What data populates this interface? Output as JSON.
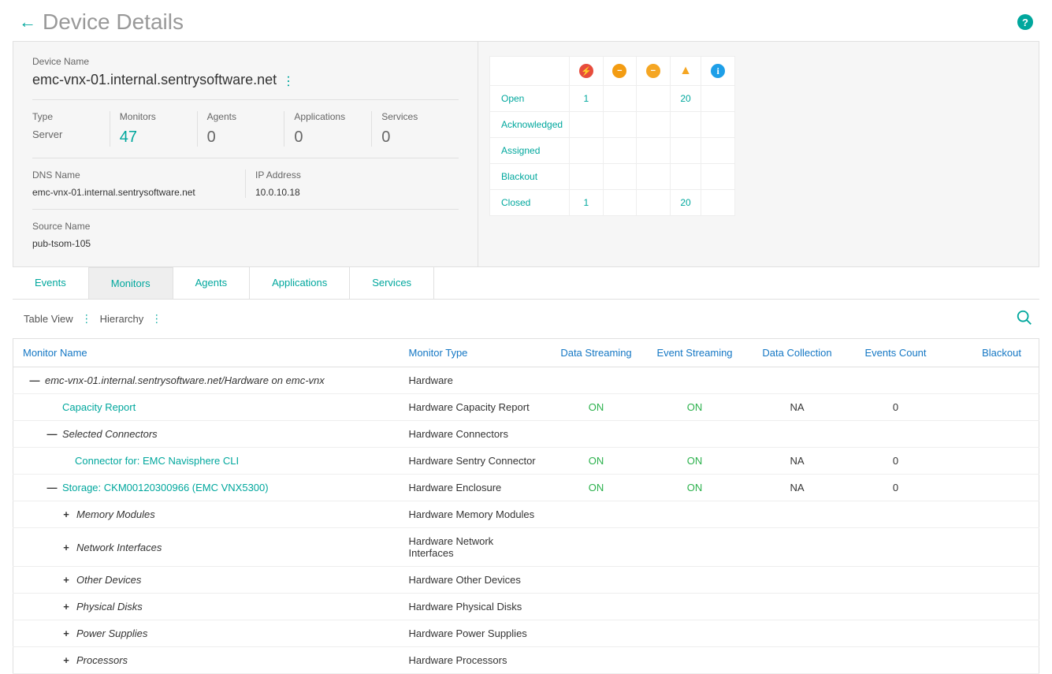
{
  "page": {
    "title": "Device Details"
  },
  "device": {
    "name_label": "Device Name",
    "name": "emc-vnx-01.internal.sentrysoftware.net",
    "type_label": "Type",
    "type": "Server",
    "monitors_label": "Monitors",
    "monitors": "47",
    "agents_label": "Agents",
    "agents": "0",
    "applications_label": "Applications",
    "applications": "0",
    "services_label": "Services",
    "services": "0",
    "dns_label": "DNS Name",
    "dns": "emc-vnx-01.internal.sentrysoftware.net",
    "ip_label": "IP Address",
    "ip": "10.0.10.18",
    "source_label": "Source Name",
    "source": "pub-tsom-105"
  },
  "events": {
    "rows": {
      "open": {
        "label": "Open",
        "critical": "1",
        "major": "",
        "minor": "",
        "warning": "20",
        "info": ""
      },
      "ack": {
        "label": "Acknowledged",
        "critical": "",
        "major": "",
        "minor": "",
        "warning": "",
        "info": ""
      },
      "assigned": {
        "label": "Assigned",
        "critical": "",
        "major": "",
        "minor": "",
        "warning": "",
        "info": ""
      },
      "blackout": {
        "label": "Blackout",
        "critical": "",
        "major": "",
        "minor": "",
        "warning": "",
        "info": ""
      },
      "closed": {
        "label": "Closed",
        "critical": "1",
        "major": "",
        "minor": "",
        "warning": "20",
        "info": ""
      }
    }
  },
  "tabs": {
    "events": "Events",
    "monitors": "Monitors",
    "agents": "Agents",
    "applications": "Applications",
    "services": "Services"
  },
  "viewbar": {
    "table_view": "Table View",
    "hierarchy": "Hierarchy"
  },
  "columns": {
    "name": "Monitor Name",
    "type": "Monitor Type",
    "ds": "Data Streaming",
    "es": "Event Streaming",
    "dc": "Data Collection",
    "ec": "Events Count",
    "bo": "Blackout"
  },
  "rows": [
    {
      "indent": 0,
      "toggle": "—",
      "name": "emc-vnx-01.internal.sentrysoftware.net/Hardware on emc-vnx",
      "style": "italic",
      "type": "Hardware",
      "ds": "",
      "es": "",
      "dc": "",
      "ec": "",
      "bo": ""
    },
    {
      "indent": 1,
      "toggle": "",
      "name": "Capacity Report",
      "style": "link",
      "type": "Hardware Capacity Report",
      "ds": "ON",
      "es": "ON",
      "dc": "NA",
      "ec": "0",
      "bo": ""
    },
    {
      "indent": 1,
      "toggle": "—",
      "name": "Selected Connectors",
      "style": "italic",
      "type": "Hardware Connectors",
      "ds": "",
      "es": "",
      "dc": "",
      "ec": "",
      "bo": ""
    },
    {
      "indent": 2,
      "toggle": "",
      "name": "Connector for: EMC Navisphere CLI",
      "style": "link",
      "type": "Hardware Sentry Connector",
      "ds": "ON",
      "es": "ON",
      "dc": "NA",
      "ec": "0",
      "bo": ""
    },
    {
      "indent": 1,
      "toggle": "—",
      "name": "Storage: CKM00120300966 (EMC VNX5300)",
      "style": "link",
      "type": "Hardware Enclosure",
      "ds": "ON",
      "es": "ON",
      "dc": "NA",
      "ec": "0",
      "bo": ""
    },
    {
      "indent": 3,
      "toggle": "+",
      "name": "Memory Modules",
      "style": "italic",
      "type": "Hardware Memory Modules",
      "ds": "",
      "es": "",
      "dc": "",
      "ec": "",
      "bo": ""
    },
    {
      "indent": 3,
      "toggle": "+",
      "name": "Network Interfaces",
      "style": "italic",
      "type": "Hardware Network Interfaces",
      "ds": "",
      "es": "",
      "dc": "",
      "ec": "",
      "bo": ""
    },
    {
      "indent": 3,
      "toggle": "+",
      "name": "Other Devices",
      "style": "italic",
      "type": "Hardware Other Devices",
      "ds": "",
      "es": "",
      "dc": "",
      "ec": "",
      "bo": ""
    },
    {
      "indent": 3,
      "toggle": "+",
      "name": "Physical Disks",
      "style": "italic",
      "type": "Hardware Physical Disks",
      "ds": "",
      "es": "",
      "dc": "",
      "ec": "",
      "bo": ""
    },
    {
      "indent": 3,
      "toggle": "+",
      "name": "Power Supplies",
      "style": "italic",
      "type": "Hardware Power Supplies",
      "ds": "",
      "es": "",
      "dc": "",
      "ec": "",
      "bo": ""
    },
    {
      "indent": 3,
      "toggle": "+",
      "name": "Processors",
      "style": "italic",
      "type": "Hardware Processors",
      "ds": "",
      "es": "",
      "dc": "",
      "ec": "",
      "bo": ""
    }
  ]
}
